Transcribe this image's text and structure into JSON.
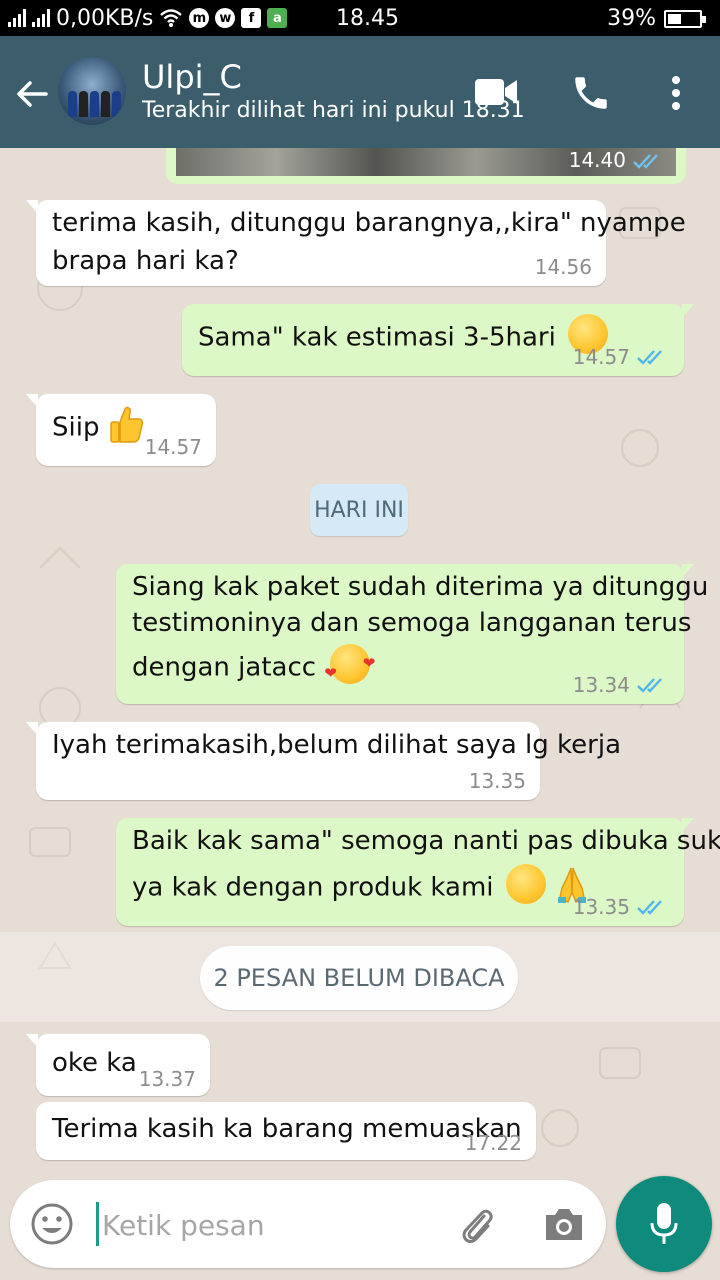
{
  "status_bar": {
    "net_speed": "0,00KB/s",
    "time": "18.45",
    "battery": "39%",
    "battery_level_percent": 39
  },
  "header": {
    "contact_name": "Ulpi_C",
    "last_seen": "Terakhir dilihat hari ini pukul 18.31"
  },
  "chat": {
    "partial_top_time": "14.40",
    "date_divider": "HARI INI",
    "unread_divider": "2 PESAN BELUM DIBACA",
    "messages": [
      {
        "direction": "in",
        "lines": [
          "terima kasih, ditunggu barangnya,,kira\" nyampe",
          "brapa hari ka?"
        ],
        "time": "14.56"
      },
      {
        "direction": "out",
        "lines": [
          "Sama\" kak estimasi 3-5hari"
        ],
        "emoji": "smiling-face",
        "time": "14.57",
        "status": "read"
      },
      {
        "direction": "in",
        "lines": [
          "Siip"
        ],
        "emoji": "thumbs-up",
        "time": "14.57"
      },
      {
        "direction": "out",
        "lines": [
          "Siang kak paket sudah diterima ya ditunggu",
          "testimoninya dan semoga langganan terus",
          "dengan jatacc"
        ],
        "emoji": "smiling-face-with-hearts",
        "time": "13.34",
        "status": "read"
      },
      {
        "direction": "in",
        "lines": [
          "Iyah terimakasih,belum dilihat saya lg kerja"
        ],
        "time": "13.35"
      },
      {
        "direction": "out",
        "lines": [
          "Baik kak sama\" semoga nanti pas dibuka suka",
          "ya kak dengan produk kami"
        ],
        "emoji": "smiling-face, folded-hands",
        "time": "13.35",
        "status": "read"
      },
      {
        "direction": "in",
        "lines": [
          "oke ka"
        ],
        "time": "13.37"
      },
      {
        "direction": "in",
        "lines": [
          "Terima kasih ka barang memuaskan"
        ],
        "time": "17.22"
      }
    ]
  },
  "composer": {
    "placeholder": "Ketik pesan"
  },
  "colors": {
    "header": "#3c5e6c",
    "outgoing_bubble": "#dcf8c6",
    "incoming_bubble": "#ffffff",
    "chat_bg": "#e6ddd4",
    "read_ticks": "#4fb6ec",
    "mic_button": "#0e8b7c"
  },
  "icons": [
    "back-arrow-icon",
    "video-call-icon",
    "phone-icon",
    "more-vert-icon",
    "emoji-icon",
    "attach-icon",
    "camera-icon",
    "mic-icon"
  ]
}
